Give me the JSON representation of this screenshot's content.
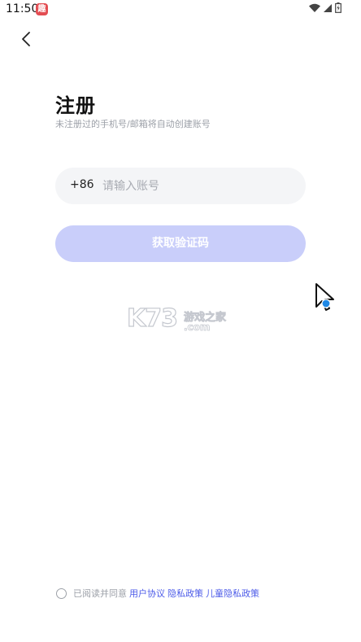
{
  "status_bar": {
    "time": "11:50",
    "notification_icon_text": "趣"
  },
  "header": {
    "title": "注册",
    "subtitle": "未注册过的手机号/邮箱将自动创建账号"
  },
  "account_field": {
    "country_code": "+86",
    "placeholder": "请输入账号",
    "value": ""
  },
  "get_code_button": {
    "label": "获取验证码"
  },
  "watermark": {
    "brand": "K73",
    "tagline": "游戏之家",
    "domain": ".com"
  },
  "agreement": {
    "prefix": "已阅读并同意",
    "links": [
      "用户协议",
      "隐私政策",
      "儿童隐私政策"
    ]
  },
  "colors": {
    "primary": "#c9cefa",
    "link": "#4c5be8",
    "muted_text": "#9ca0a8",
    "field_bg": "#f4f5f7"
  }
}
